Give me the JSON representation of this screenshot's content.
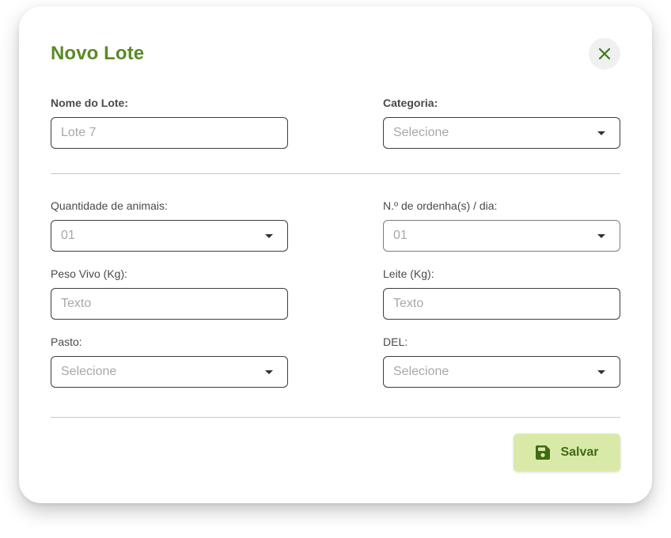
{
  "modal": {
    "title": "Novo Lote",
    "close_icon": "close-icon"
  },
  "fields": {
    "nome_lote": {
      "label": "Nome do Lote:",
      "placeholder": "Lote 7"
    },
    "categoria": {
      "label": "Categoria:",
      "placeholder": "Selecione"
    },
    "quantidade_animais": {
      "label": "Quantidade de animais:",
      "placeholder": "01"
    },
    "ordenhas_dia": {
      "label": "N.º de ordenha(s) / dia:",
      "placeholder": "01"
    },
    "peso_vivo": {
      "label": "Peso Vivo (Kg):",
      "placeholder": "Texto"
    },
    "leite": {
      "label": "Leite (Kg):",
      "placeholder": "Texto"
    },
    "pasto": {
      "label": "Pasto:",
      "placeholder": "Selecione"
    },
    "del": {
      "label": "DEL:",
      "placeholder": "Selecione"
    }
  },
  "actions": {
    "save_label": "Salvar",
    "save_icon": "floppy-disk-icon"
  },
  "colors": {
    "accent": "#5b8a25",
    "save_bg": "#d9eaa8",
    "save_text": "#3f6b12"
  }
}
